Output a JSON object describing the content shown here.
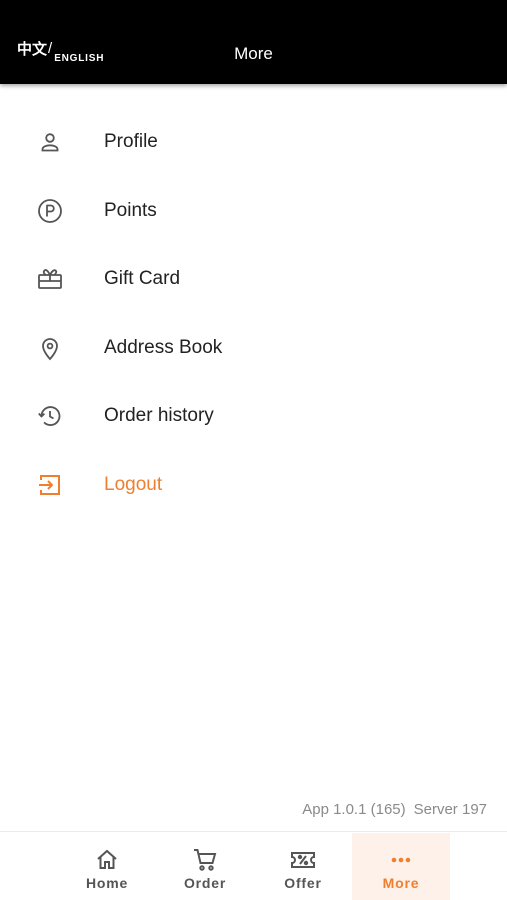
{
  "header": {
    "title": "More",
    "lang_zh": "中文",
    "lang_separator": "/",
    "lang_en": "ENGLISH"
  },
  "menu": {
    "items": [
      {
        "label": "Profile",
        "icon": "person-icon"
      },
      {
        "label": "Points",
        "icon": "points-icon"
      },
      {
        "label": "Gift Card",
        "icon": "gift-card-icon"
      },
      {
        "label": "Address Book",
        "icon": "location-pin-icon"
      },
      {
        "label": "Order history",
        "icon": "history-icon"
      },
      {
        "label": "Logout",
        "icon": "logout-icon"
      }
    ]
  },
  "footer": {
    "app_version": "App 1.0.1 (165)",
    "server_version": "Server 197"
  },
  "bottom_nav": {
    "items": [
      {
        "label": "Home",
        "icon": "home-icon"
      },
      {
        "label": "Order",
        "icon": "cart-icon"
      },
      {
        "label": "Offer",
        "icon": "coupon-icon"
      },
      {
        "label": "More",
        "icon": "more-dots-icon"
      }
    ],
    "active": "More"
  },
  "colors": {
    "accent": "#ef7f2f",
    "header_bg": "#000000",
    "icon_gray": "#555555",
    "active_tab_bg": "#fdf1ea"
  }
}
